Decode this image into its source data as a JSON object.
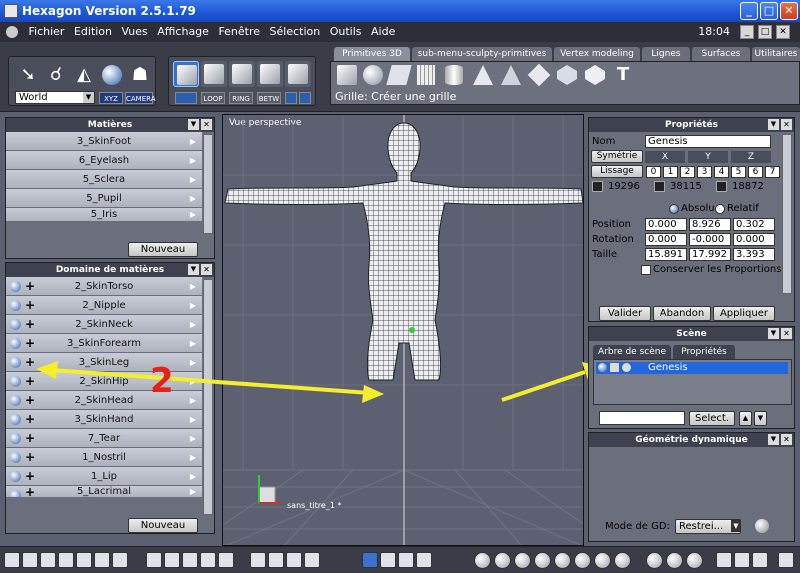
{
  "window": {
    "title": "Hexagon Version 2.5.1.79",
    "minimize": "_",
    "maximize": "□",
    "close": "✕"
  },
  "menu": {
    "items": [
      "Fichier",
      "Edition",
      "Vues",
      "Affichage",
      "Fenêtre",
      "Sélection",
      "Outils",
      "Aide"
    ],
    "clock": "18:04"
  },
  "toolbar": {
    "tabs": [
      "Primitives 3D",
      "sub-menu-sculpty-primitives",
      "Vertex modeling",
      "Lignes",
      "Surfaces",
      "Utilitaires"
    ],
    "coord_dropdown": "World",
    "xyz_label": "XYZ",
    "camera_label": "CAMERA",
    "select_modes": [
      "LOOP",
      "RING",
      "BETW"
    ],
    "status_text": "Grille: Créer une grille"
  },
  "materials_panel": {
    "title": "Matières",
    "items": [
      "3_SkinFoot",
      "6_Eyelash",
      "5_Sclera",
      "5_Pupil",
      "5_Iris"
    ],
    "new_button": "Nouveau"
  },
  "domain_panel": {
    "title": "Domaine de matières",
    "items": [
      "2_SkinTorso",
      "2_Nipple",
      "2_SkinNeck",
      "3_SkinForearm",
      "3_SkinLeg",
      "2_SkinHip",
      "2_SkinHead",
      "3_SkinHand",
      "7_Tear",
      "1_Nostril",
      "1_Lip",
      "5_Lacrimal"
    ],
    "new_button": "Nouveau"
  },
  "viewport": {
    "label": "Vue perspective",
    "file_label": "sans_titre_1 *",
    "annotation_number": "2"
  },
  "properties_panel": {
    "title": "Propriétés",
    "name_label": "Nom",
    "name_value": "Genesis",
    "symmetry_button": "Symétrie",
    "axes": [
      "X",
      "Y",
      "Z"
    ],
    "smoothing_button": "Lissage",
    "smoothing_levels": [
      "0",
      "1",
      "2",
      "3",
      "4",
      "5",
      "6",
      "7"
    ],
    "counts": [
      "19296",
      "38115",
      "18872"
    ],
    "absolute_label": "Absolu",
    "relative_label": "Relatif",
    "position_label": "Position",
    "position": [
      "0.000",
      "8.926",
      "0.302"
    ],
    "rotation_label": "Rotation",
    "rotation": [
      "0.000",
      "-0.000",
      "0.000"
    ],
    "size_label": "Taille",
    "size": [
      "15.891",
      "17.992",
      "3.393"
    ],
    "keep_proportions": "Conserver les Proportions",
    "validate_button": "Valider",
    "cancel_button": "Abandon",
    "apply_button": "Appliquer"
  },
  "scene_panel": {
    "title": "Scène",
    "tabs": [
      "Arbre de scène",
      "Propriétés"
    ],
    "tree_item": "Genesis",
    "select_button": "Select."
  },
  "dynamic_geometry_panel": {
    "title": "Géométrie dynamique",
    "gd_mode_label": "Mode de GD:",
    "gd_mode_value": "Restrei..."
  },
  "colors": {
    "arrow": "#f5ee2a",
    "annotation": "#e8211b",
    "selection": "#2266dd"
  }
}
